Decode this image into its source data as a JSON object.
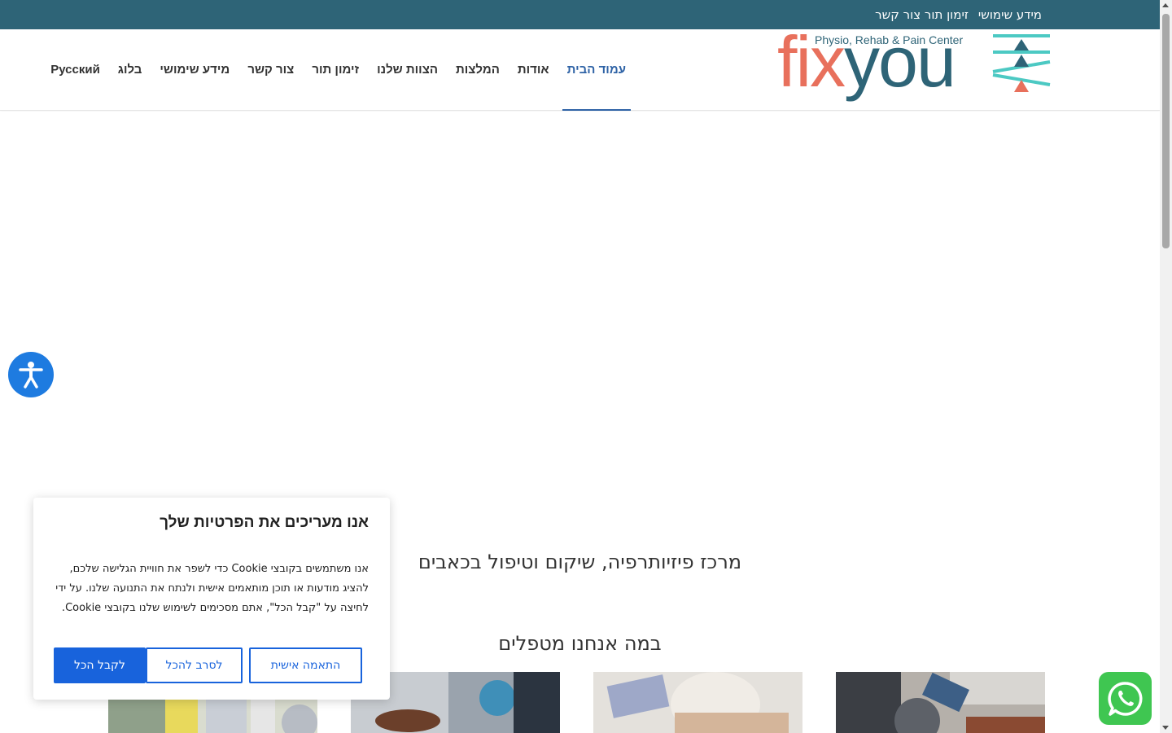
{
  "topbar": {
    "links": [
      "מידע שימושי",
      "זימון תור צור קשר"
    ]
  },
  "logo": {
    "word_fix": "fix",
    "word_you": "you",
    "tagline": "Physio, Rehab & Pain Center"
  },
  "nav": {
    "items": [
      {
        "label": "עמוד הבית",
        "active": true
      },
      {
        "label": "אודות"
      },
      {
        "label": "המלצות"
      },
      {
        "label": "הצוות שלנו"
      },
      {
        "label": "זימון תור"
      },
      {
        "label": "צור קשר"
      },
      {
        "label": "מידע שימושי"
      },
      {
        "label": "בלוג"
      },
      {
        "label": "Русский"
      }
    ]
  },
  "main": {
    "subtitle": "מרכז פיזיותרפיה, שיקום וטיפול בכאבים",
    "section_title": "במה אנחנו מטפלים"
  },
  "cookie": {
    "title": "אנו מעריכים את הפרטיות שלך",
    "text": "אנו משתמשים בקובצי Cookie כדי לשפר את חוויית הגלישה שלכם, להציג מודעות או תוכן מותאמים אישית ולנתח את התנועה שלנו. על ידי לחיצה על \"קבל הכל\", אתם מסכימים לשימוש שלנו בקובצי Cookie.",
    "customize_label": "התאמה אישית",
    "reject_label": "לסרב להכל",
    "accept_label": "לקבל הכל"
  },
  "icons": {
    "accessibility": "accessibility-icon",
    "whatsapp": "whatsapp-icon"
  },
  "colors": {
    "topbar": "#2e6477",
    "nav_active": "#2f63a6",
    "logo_coral": "#e8705c",
    "logo_teal": "#2e6477",
    "logo_aqua": "#4cc9c3",
    "cookie_button": "#1863dc",
    "accessibility": "#1e7be0",
    "whatsapp": "#3fc651"
  }
}
